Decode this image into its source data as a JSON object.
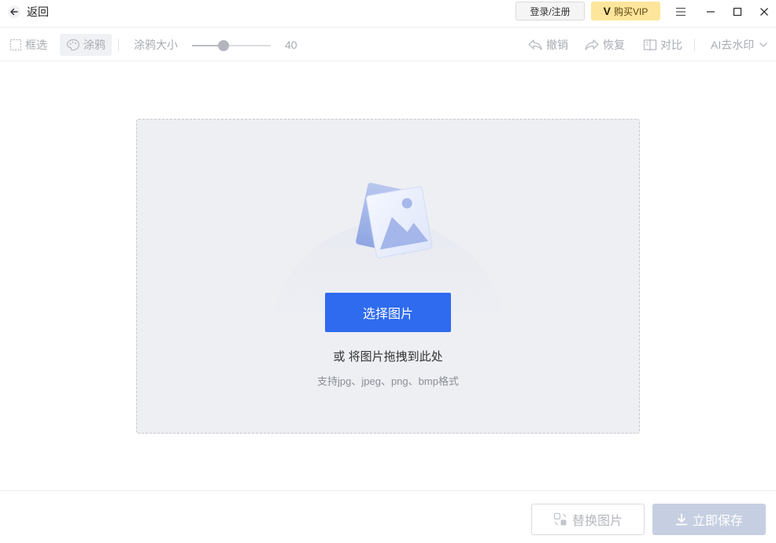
{
  "titlebar": {
    "back_label": "返回",
    "login_label": "登录/注册",
    "vip_letter": "V",
    "vip_label": "购买VIP"
  },
  "toolbar": {
    "box_select_label": "框选",
    "brush_label": "涂鸦",
    "brush_size_label": "涂鸦大小",
    "brush_size_value": "40",
    "brush_size_fraction": 0.4,
    "undo_label": "撤销",
    "redo_label": "恢复",
    "compare_label": "对比",
    "ai_label": "AI去水印"
  },
  "dropzone": {
    "select_button": "选择图片",
    "drag_text": "或 将图片拖拽到此处",
    "formats_text": "支持jpg、jpeg、png、bmp格式"
  },
  "bottombar": {
    "replace_label": "替换图片",
    "save_label": "立即保存"
  },
  "colors": {
    "accent": "#2f6bef",
    "vip": "#fde69b",
    "disabled_save": "#c6cfe1"
  }
}
